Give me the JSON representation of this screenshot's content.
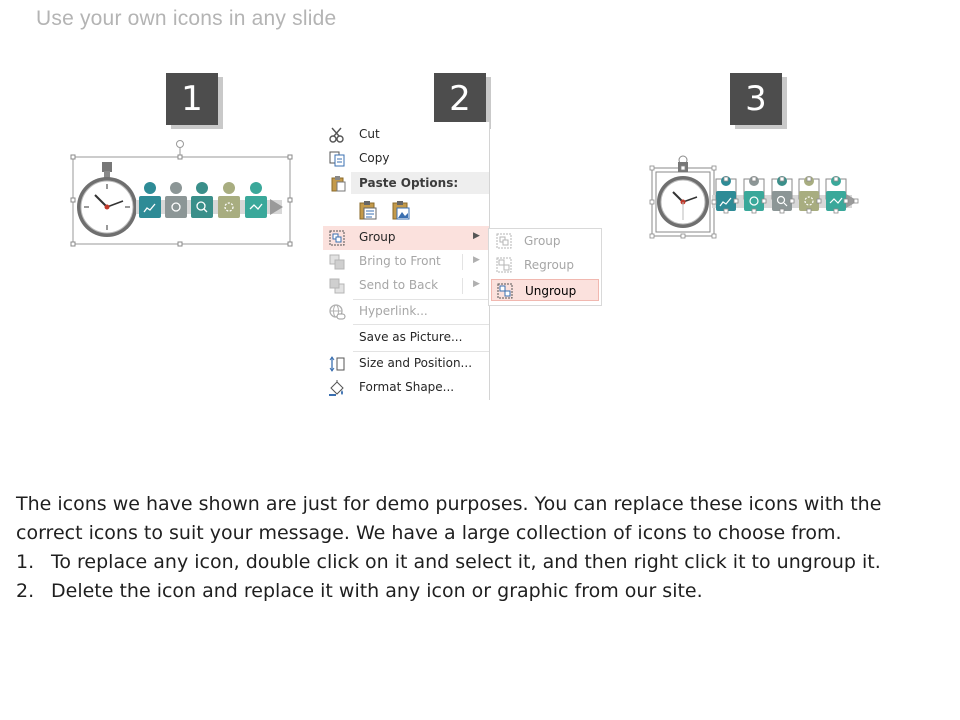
{
  "slide": {
    "title": "Use your own icons in any slide",
    "steps": [
      "1",
      "2",
      "3"
    ]
  },
  "context_menu": {
    "cut": "Cut",
    "copy": "Copy",
    "paste_options": "Paste Options:",
    "group": "Group",
    "bring_to_front": "Bring to Front",
    "send_to_back": "Send to Back",
    "hyperlink": "Hyperlink...",
    "save_as_picture": "Save as Picture...",
    "size_and_position": "Size and Position...",
    "format_shape": "Format Shape..."
  },
  "submenu": {
    "group": "Group",
    "regroup": "Regroup",
    "ungroup": "Ungroup"
  },
  "body": {
    "intro": "The icons we have shown are just for demo purposes. You can replace these icons with the correct icons to suit your message. We have a large collection of icons to choose from.",
    "items": [
      {
        "num": "1.",
        "text": "To replace any icon, double click on it and select it, and then right click it to ungroup it."
      },
      {
        "num": "2.",
        "text": "Delete the icon and replace it with any icon or graphic from our site."
      }
    ]
  },
  "colors": {
    "badge": "#4d4d4d",
    "teal_dark": "#2e8b96",
    "teal": "#3aa89a",
    "gray": "#8c9696",
    "olive": "#a8ad80",
    "highlight": "#fbe1dd"
  }
}
